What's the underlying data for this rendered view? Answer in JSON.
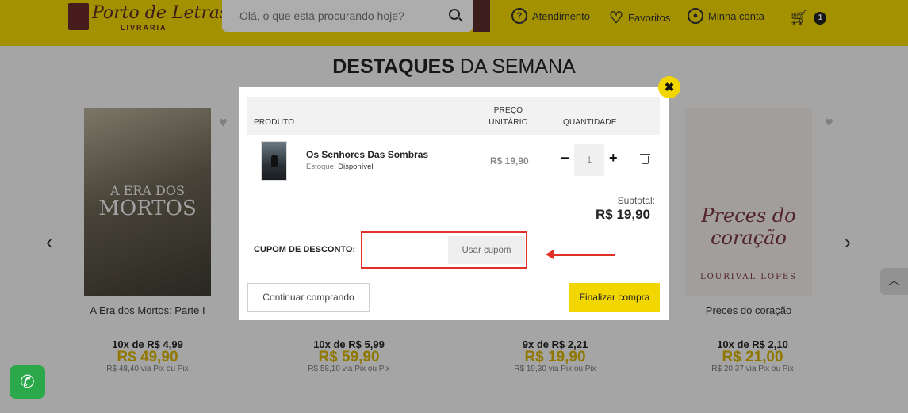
{
  "header": {
    "logo_text": "Porto de Letras",
    "logo_sub": "LIVRARIA",
    "search_placeholder": "Olá, o que está procurando hoje?",
    "nav": {
      "atendimento": "Atendimento",
      "favoritos": "Favoritos",
      "conta": "Minha conta",
      "cart_count": "1"
    }
  },
  "page": {
    "title_bold": "DESTAQUES",
    "title_rest": " DA SEMANA",
    "books": [
      {
        "title": "A Era dos Mortos: Parte I",
        "cover_line1": "A ERA DOS",
        "cover_line2": "MORTOS",
        "installments": "10x de R$ 4,99",
        "price": "R$ 49,90",
        "pix": "R$ 48,40 via Pix ou Pix"
      },
      {
        "title": "",
        "installments": "10x de R$ 5,99",
        "price": "R$ 59,90",
        "pix": "R$ 58,10 via Pix ou Pix"
      },
      {
        "title": "",
        "installments": "9x de R$ 2,21",
        "price": "R$ 19,90",
        "pix": "R$ 19,30 via Pix ou Pix"
      },
      {
        "title": "Preces do coração",
        "cover_line1": "Preces do",
        "cover_line2": "coração",
        "cover_author": "LOURIVAL LOPES",
        "installments": "10x de R$ 2,10",
        "price": "R$ 21,00",
        "pix": "R$ 20,37 via Pix ou Pix"
      }
    ]
  },
  "modal": {
    "columns": {
      "product": "PRODUTO",
      "price": "PREÇO UNITÁRIO",
      "qty": "QUANTIDADE"
    },
    "item": {
      "name": "Os Senhores Das Sombras",
      "stock_label": "Estoque:",
      "stock_value": "Disponível",
      "unit_price": "R$ 19,90",
      "qty": "1"
    },
    "subtotal_label": "Subtotal:",
    "subtotal_value": "R$ 19,90",
    "coupon_label": "CUPOM DE DESCONTO:",
    "coupon_button": "Usar cupom",
    "continue_button": "Continuar comprando",
    "finish_button": "Finalizar compra"
  },
  "colors": {
    "brand_yellow": "#f2d600",
    "annotation_red": "#e0312b"
  }
}
